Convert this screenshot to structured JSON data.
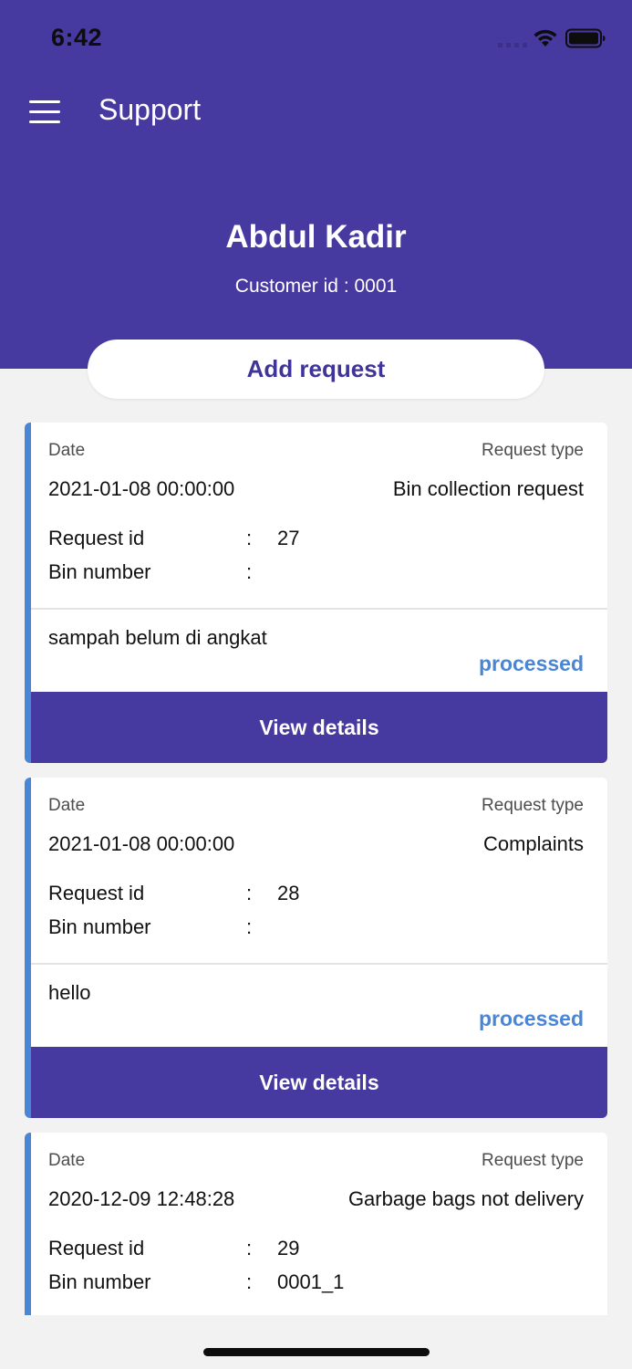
{
  "status_bar": {
    "time": "6:42",
    "signal_icon": "signal-dots-icon",
    "wifi_icon": "wifi-icon",
    "battery_icon": "battery-icon",
    "header_color": "#4639a0"
  },
  "appbar": {
    "menu_icon": "hamburger-menu-icon",
    "title": "Support"
  },
  "profile": {
    "name": "Abdul Kadir",
    "customer_id": "Customer id : 0001"
  },
  "add_request_label": "Add request",
  "labels": {
    "date": "Date",
    "request_type": "Request type",
    "request_id": "Request id",
    "bin_number": "Bin number",
    "colon": ":",
    "view_details": "View details"
  },
  "status_color": "#4a86d6",
  "requests": [
    {
      "date": "2021-01-08 00:00:00",
      "type": "Bin collection request",
      "request_id": "27",
      "bin_number": "",
      "description": "sampah belum di angkat",
      "status": "processed"
    },
    {
      "date": "2021-01-08 00:00:00",
      "type": "Complaints",
      "request_id": "28",
      "bin_number": "",
      "description": "hello",
      "status": "processed"
    },
    {
      "date": "2020-12-09 12:48:28",
      "type": "Garbage bags not delivery",
      "request_id": "29",
      "bin_number": "0001_1",
      "description": "",
      "status": ""
    }
  ]
}
